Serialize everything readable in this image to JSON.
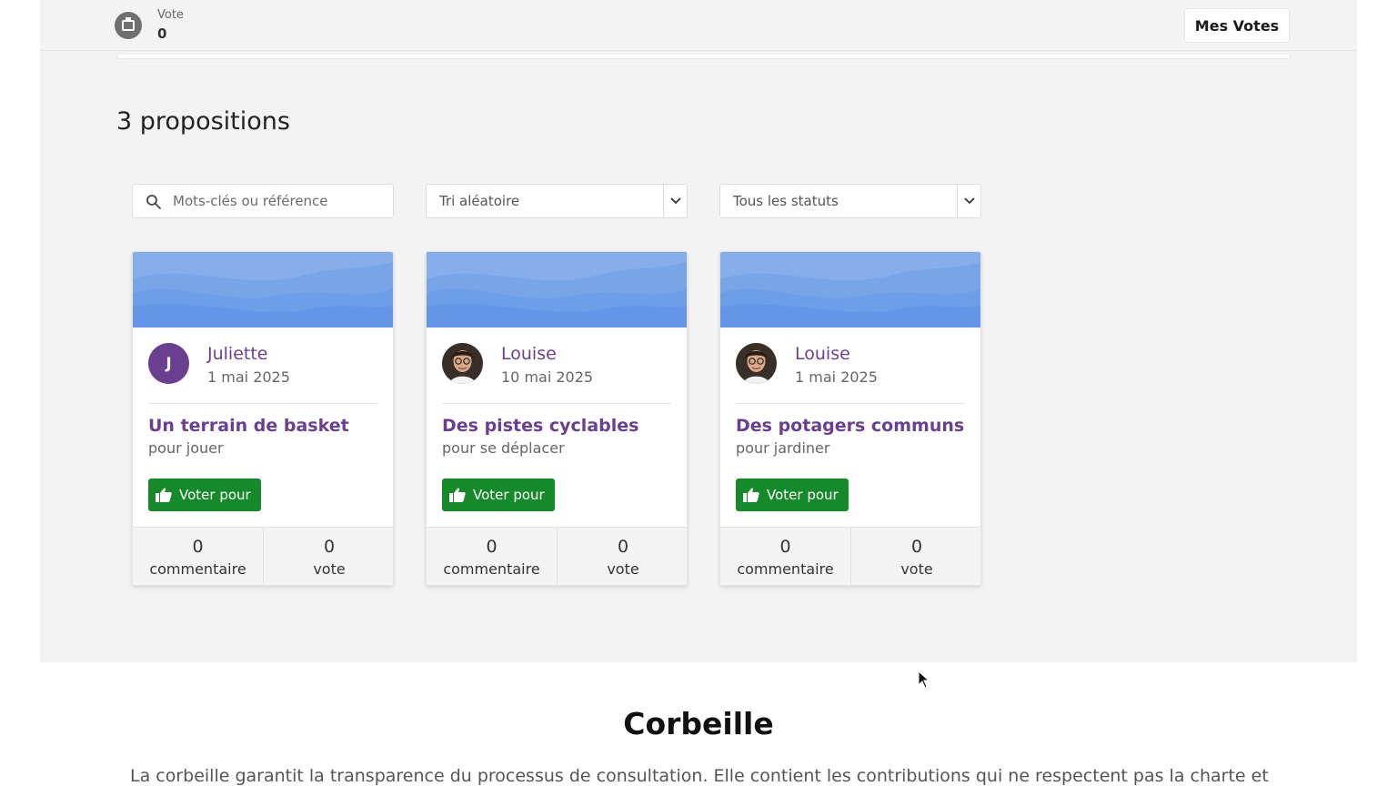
{
  "header": {
    "vote_label": "Vote",
    "vote_count": "0",
    "my_votes_button": "Mes Votes"
  },
  "proposals": {
    "heading": "3 propositions",
    "search_placeholder": "Mots-clés ou référence",
    "sort_selected": "Tri aléatoire",
    "status_selected": "Tous les statuts",
    "cards": [
      {
        "author": "Juliette",
        "avatar_initial": "J",
        "date": "1 mai 2025",
        "title": "Un terrain de basket",
        "subtitle": "pour jouer",
        "vote_button": "Voter pour",
        "comment_count": "0",
        "comment_label": "commentaire",
        "vote_count": "0",
        "vote_label": "vote"
      },
      {
        "author": "Louise",
        "date": "10 mai 2025",
        "title": "Des pistes cyclables",
        "subtitle": "pour se déplacer",
        "vote_button": "Voter pour",
        "comment_count": "0",
        "comment_label": "commentaire",
        "vote_count": "0",
        "vote_label": "vote"
      },
      {
        "author": "Louise",
        "date": "1 mai 2025",
        "title": "Des potagers communs",
        "subtitle": "pour jardiner",
        "vote_button": "Voter pour",
        "comment_count": "0",
        "comment_label": "commentaire",
        "vote_count": "0",
        "vote_label": "vote"
      }
    ]
  },
  "corbeille": {
    "title": "Corbeille",
    "text": "La corbeille garantit la transparence du processus de consultation. Elle contient les contributions qui ne respectent pas la charte et"
  },
  "colors": {
    "accent_purple": "#6b3f8f",
    "vote_green": "#168a2a",
    "banner_blue": "#6d9ee8"
  }
}
